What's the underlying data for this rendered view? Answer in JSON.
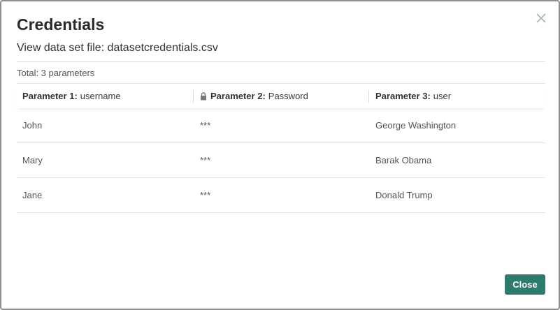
{
  "dialog": {
    "title": "Credentials",
    "subtitle": "View data set file: datasetcredentials.csv",
    "total": "Total: 3 parameters",
    "close_label": "Close"
  },
  "table": {
    "columns": [
      {
        "prefix": "Parameter 1:",
        "name": "username",
        "locked": false
      },
      {
        "prefix": "Parameter 2:",
        "name": "Password",
        "locked": true
      },
      {
        "prefix": "Parameter 3:",
        "name": "user",
        "locked": false
      }
    ],
    "rows": [
      [
        "John",
        "***",
        "George Washington"
      ],
      [
        "Mary",
        "***",
        "Barak Obama"
      ],
      [
        "Jane",
        "***",
        "Donald Trump"
      ]
    ]
  },
  "colors": {
    "accent": "#2e7a6c",
    "border": "#8d8d8d"
  }
}
